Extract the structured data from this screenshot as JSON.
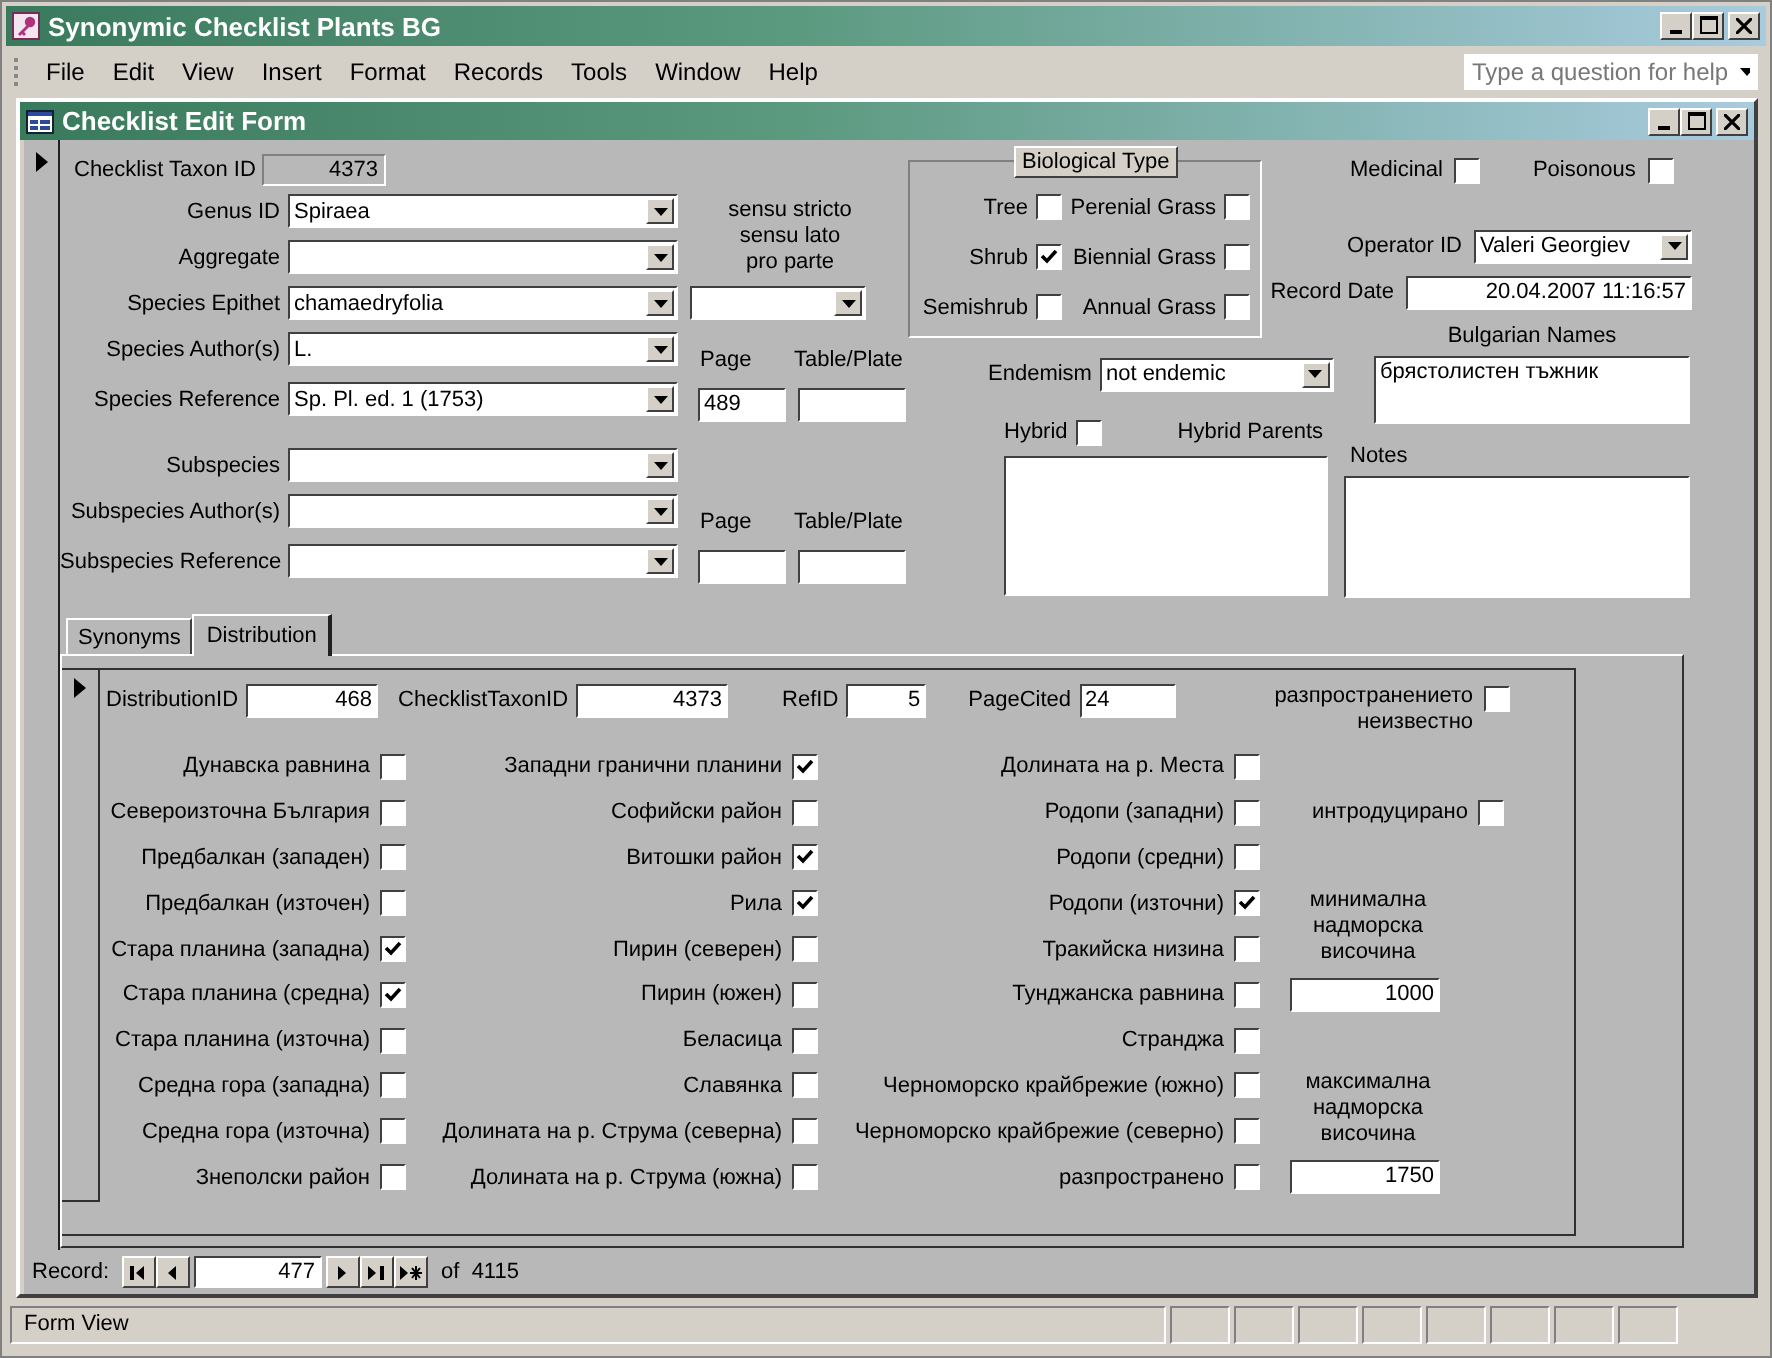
{
  "app": {
    "title": "Synonymic Checklist Plants BG"
  },
  "menu": [
    "File",
    "Edit",
    "View",
    "Insert",
    "Format",
    "Records",
    "Tools",
    "Window",
    "Help"
  ],
  "help_box": {
    "placeholder": "Type a question for help"
  },
  "form_window": {
    "title": "Checklist Edit Form"
  },
  "taxon_id": {
    "label": "Checklist Taxon ID",
    "value": "4373"
  },
  "fields": [
    {
      "label": "Genus ID",
      "value": "Spiraea"
    },
    {
      "label": "Aggregate"
    },
    {
      "label": "Species Epithet",
      "value": "chamaedryfolia"
    },
    {
      "label": "Species Author(s)",
      "value": "L."
    },
    {
      "label": "Species Reference",
      "value": "Sp. Pl. ed. 1 (1753)"
    },
    {
      "label": "Subspecies"
    },
    {
      "label": "Subspecies Author(s)"
    },
    {
      "label": "Subspecies Reference"
    }
  ],
  "sensu": {
    "lines": [
      "sensu stricto",
      "sensu lato",
      "pro parte"
    ]
  },
  "references": [
    {
      "page_label": "Page",
      "page": "489",
      "table_label": "Table/Plate"
    },
    {
      "page_label": "Page",
      "table_label": "Table/Plate"
    }
  ],
  "biological_type": {
    "title": "Biological Type",
    "options": [
      {
        "label": "Tree",
        "checked": false
      },
      {
        "label": "Shrub",
        "checked": true
      },
      {
        "label": "Semishrub",
        "checked": false
      },
      {
        "label": "Perenial Grass",
        "checked": false
      },
      {
        "label": "Biennial Grass",
        "checked": false
      },
      {
        "label": "Annual Grass",
        "checked": false
      }
    ]
  },
  "flags": [
    {
      "label": "Medicinal",
      "checked": false
    },
    {
      "label": "Poisonous",
      "checked": false
    }
  ],
  "operator": {
    "label": "Operator ID",
    "value": "Valeri Georgiev"
  },
  "record_date": {
    "label": "Record Date",
    "value": "20.04.2007 11:16:57"
  },
  "endemism": {
    "label": "Endemism",
    "value": "not endemic"
  },
  "hybrid": {
    "label": "Hybrid",
    "checked": false,
    "parents_label": "Hybrid Parents"
  },
  "bulgarian_names": {
    "label": "Bulgarian Names",
    "value": "брястолистен тъжник"
  },
  "notes": {
    "label": "Notes"
  },
  "tabs": [
    {
      "label": "Synonyms",
      "selected": false
    },
    {
      "label": "Distribution",
      "selected": true
    }
  ],
  "distribution": {
    "fields": [
      {
        "label": "DistributionID",
        "value": "468"
      },
      {
        "label": "ChecklistTaxonID",
        "value": "4373"
      },
      {
        "label": "RefID",
        "value": "5"
      },
      {
        "label": "PageCited",
        "value": "24"
      }
    ],
    "unknown": {
      "label": "разпространението неизвестно",
      "checked": false
    },
    "columns": [
      {
        "regions": [
          {
            "label": "Дунавска равнина",
            "checked": false
          },
          {
            "label": "Североизточна България",
            "checked": false
          },
          {
            "label": "Предбалкан (западен)",
            "checked": false
          },
          {
            "label": "Предбалкан (източен)",
            "checked": false
          },
          {
            "label": "Стара планина (западна)",
            "checked": true
          },
          {
            "label": "Стара планина (средна)",
            "checked": true
          },
          {
            "label": "Стара планина (източна)",
            "checked": false
          },
          {
            "label": "Средна гора (западна)",
            "checked": false
          },
          {
            "label": "Средна гора (източна)",
            "checked": false
          },
          {
            "label": "Знеполски район",
            "checked": false
          }
        ]
      },
      {
        "regions": [
          {
            "label": "Западни гранични планини",
            "checked": true
          },
          {
            "label": "Софийски район",
            "checked": false
          },
          {
            "label": "Витошки район",
            "checked": true
          },
          {
            "label": "Рила",
            "checked": true
          },
          {
            "label": "Пирин (северен)",
            "checked": false
          },
          {
            "label": "Пирин (южен)",
            "checked": false
          },
          {
            "label": "Беласица",
            "checked": false
          },
          {
            "label": "Славянка",
            "checked": false
          },
          {
            "label": "Долината на р. Струма (северна)",
            "checked": false
          },
          {
            "label": "Долината на р. Струма (южна)",
            "checked": false
          }
        ]
      },
      {
        "regions": [
          {
            "label": "Долината на р. Места",
            "checked": false
          },
          {
            "label": "Родопи (западни)",
            "checked": false
          },
          {
            "label": "Родопи (средни)",
            "checked": false
          },
          {
            "label": "Родопи (източни)",
            "checked": true
          },
          {
            "label": "Тракийска низина",
            "checked": false
          },
          {
            "label": "Тунджанска равнина",
            "checked": false
          },
          {
            "label": "Странджа",
            "checked": false
          },
          {
            "label": "Черноморско крайбрежие (южно)",
            "checked": false
          },
          {
            "label": "Черноморско крайбрежие (северно)",
            "checked": false
          },
          {
            "label": "разпространено",
            "checked": false
          }
        ]
      }
    ],
    "extras": [
      {
        "kind": "checkbox",
        "label": "интродуцирано",
        "checked": false
      },
      {
        "kind": "caption",
        "text": "минимална надморска височина"
      },
      {
        "kind": "number",
        "value": "1000"
      },
      {
        "kind": "caption",
        "text": "максимална надморска височина"
      },
      {
        "kind": "number",
        "value": "1750"
      }
    ]
  },
  "navigator": {
    "label": "Record:",
    "current": "477",
    "total": "of  4115"
  },
  "status_bar": {
    "text": "Form View"
  }
}
